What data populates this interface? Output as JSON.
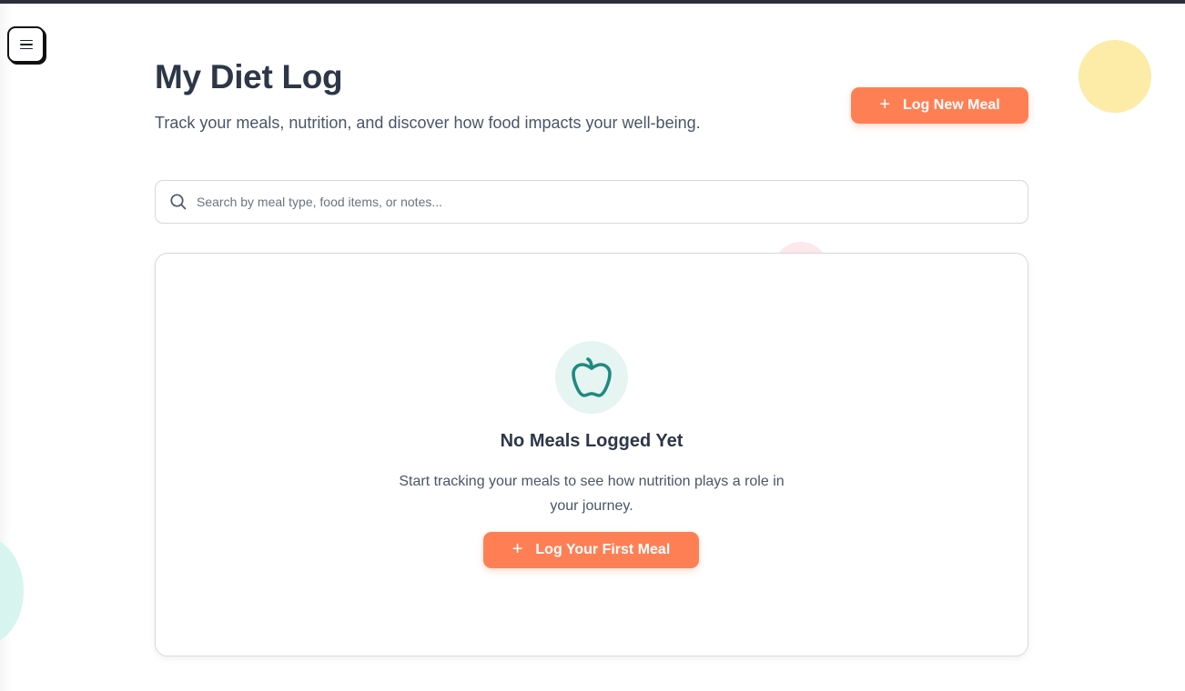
{
  "header": {
    "title": "My Diet Log",
    "subtitle": "Track your meals, nutrition, and discover how food impacts your well-being.",
    "log_button_label": "Log New Meal",
    "log_button_icon": "plus-icon"
  },
  "search": {
    "placeholder": "Search by meal type, food items, or notes...",
    "value": "",
    "icon": "search-icon"
  },
  "empty_state": {
    "icon": "apple-icon",
    "title": "No Meals Logged Yet",
    "message": "Start tracking your meals to see how nutrition plays a role in your journey.",
    "button_label": "Log Your First Meal",
    "button_icon": "plus-icon"
  },
  "nav": {
    "menu_icon": "hamburger-menu-icon"
  },
  "colors": {
    "accent": "#ff7f55",
    "icon_teal": "#1f8a7f",
    "icon_bg": "#e6f4f2",
    "decor_yellow": "#fdeba8",
    "decor_mint": "#d7f5ee",
    "decor_pink": "#fde8ec",
    "title_text": "#2d3748"
  }
}
